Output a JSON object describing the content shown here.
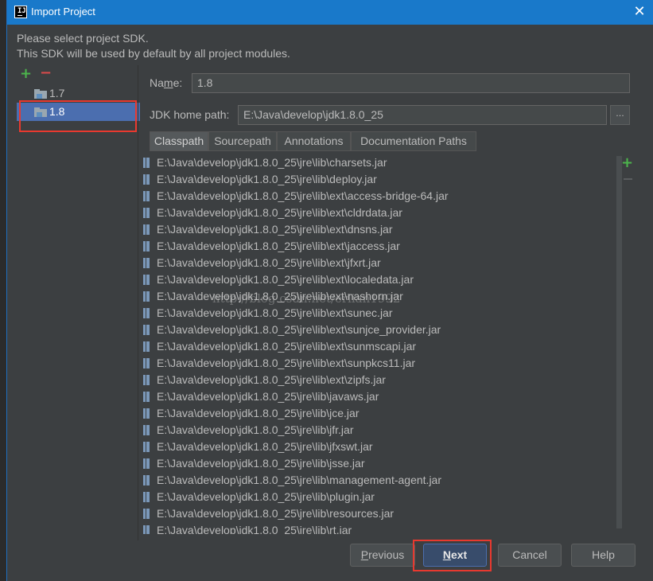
{
  "window": {
    "title": "Import Project",
    "close_glyph": "✕"
  },
  "intro": {
    "line1": "Please select project SDK.",
    "line2": "This SDK will be used by default by all project modules."
  },
  "sdk_list": {
    "add_glyph": "+",
    "remove_glyph": "−",
    "items": [
      {
        "label": "1.7",
        "selected": false
      },
      {
        "label": "1.8",
        "selected": true
      }
    ]
  },
  "form": {
    "name_label_pre": "Na",
    "name_label_u": "m",
    "name_label_post": "e:",
    "name_value": "1.8",
    "jdk_label": "JDK home path:",
    "jdk_value": "E:\\Java\\develop\\jdk1.8.0_25",
    "browse_label": "..."
  },
  "tabs": [
    {
      "label": "Classpath",
      "active": true
    },
    {
      "label": "Sourcepath",
      "active": false
    },
    {
      "label": "Annotations",
      "active": false
    },
    {
      "label": "Documentation Paths",
      "active": false
    }
  ],
  "classpath": [
    "E:\\Java\\develop\\jdk1.8.0_25\\jre\\lib\\charsets.jar",
    "E:\\Java\\develop\\jdk1.8.0_25\\jre\\lib\\deploy.jar",
    "E:\\Java\\develop\\jdk1.8.0_25\\jre\\lib\\ext\\access-bridge-64.jar",
    "E:\\Java\\develop\\jdk1.8.0_25\\jre\\lib\\ext\\cldrdata.jar",
    "E:\\Java\\develop\\jdk1.8.0_25\\jre\\lib\\ext\\dnsns.jar",
    "E:\\Java\\develop\\jdk1.8.0_25\\jre\\lib\\ext\\jaccess.jar",
    "E:\\Java\\develop\\jdk1.8.0_25\\jre\\lib\\ext\\jfxrt.jar",
    "E:\\Java\\develop\\jdk1.8.0_25\\jre\\lib\\ext\\localedata.jar",
    "E:\\Java\\develop\\jdk1.8.0_25\\jre\\lib\\ext\\nashorn.jar",
    "E:\\Java\\develop\\jdk1.8.0_25\\jre\\lib\\ext\\sunec.jar",
    "E:\\Java\\develop\\jdk1.8.0_25\\jre\\lib\\ext\\sunjce_provider.jar",
    "E:\\Java\\develop\\jdk1.8.0_25\\jre\\lib\\ext\\sunmscapi.jar",
    "E:\\Java\\develop\\jdk1.8.0_25\\jre\\lib\\ext\\sunpkcs11.jar",
    "E:\\Java\\develop\\jdk1.8.0_25\\jre\\lib\\ext\\zipfs.jar",
    "E:\\Java\\develop\\jdk1.8.0_25\\jre\\lib\\javaws.jar",
    "E:\\Java\\develop\\jdk1.8.0_25\\jre\\lib\\jce.jar",
    "E:\\Java\\develop\\jdk1.8.0_25\\jre\\lib\\jfr.jar",
    "E:\\Java\\develop\\jdk1.8.0_25\\jre\\lib\\jfxswt.jar",
    "E:\\Java\\develop\\jdk1.8.0_25\\jre\\lib\\jsse.jar",
    "E:\\Java\\develop\\jdk1.8.0_25\\jre\\lib\\management-agent.jar",
    "E:\\Java\\develop\\jdk1.8.0_25\\jre\\lib\\plugin.jar",
    "E:\\Java\\develop\\jdk1.8.0_25\\jre\\lib\\resources.jar",
    "E:\\Java\\develop\\jdk1.8.0_25\\jre\\lib\\rt.jar"
  ],
  "list_tools": {
    "add_glyph": "+"
  },
  "watermark": "http://blog.csdn.net/erlian1992",
  "buttons": {
    "previous_u": "P",
    "previous_rest": "revious",
    "next_u": "N",
    "next_rest": "ext",
    "cancel": "Cancel",
    "help": "Help"
  },
  "colors": {
    "titlebar": "#1979ca",
    "selection": "#4b6eaf",
    "highlight": "#e8392f",
    "add": "#4cb54c",
    "remove": "#d94b4b"
  }
}
